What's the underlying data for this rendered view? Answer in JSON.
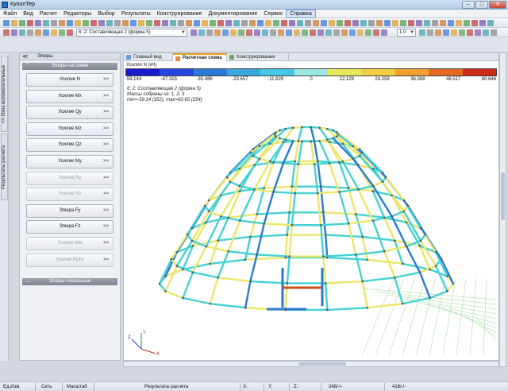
{
  "window": {
    "title": "КуполТер",
    "min": "–",
    "max": "□",
    "close": "✕"
  },
  "menu": [
    "Файл",
    "Вид",
    "Расчет",
    "Редакторы",
    "Выбор",
    "Результаты",
    "Конструирование",
    "Документирование",
    "Сервис",
    "Справка"
  ],
  "toolbar": {
    "combo_label": "6: 2: Составляющая 2 (форма 5)",
    "combo_small": "1.0"
  },
  "left_strip": {
    "tab1": "<< Окна вспомогательные",
    "tab2": "Результаты расчета"
  },
  "panel": {
    "header": "Эпюры",
    "section_scheme": "Эпюры на схеме",
    "buttons": [
      {
        "label": "Усилие N",
        "enabled": true
      },
      {
        "label": "Усилие Mx",
        "enabled": true
      },
      {
        "label": "Усилие Qy",
        "enabled": true
      },
      {
        "label": "Усилие Mz",
        "enabled": true
      },
      {
        "label": "Усилие Qz",
        "enabled": true
      },
      {
        "label": "Усилие My",
        "enabled": true
      },
      {
        "label": "Усилие Ry",
        "enabled": false
      },
      {
        "label": "Усилие Rz",
        "enabled": false
      },
      {
        "label": "Эпюра Fy",
        "enabled": true
      },
      {
        "label": "Эпюра Fz",
        "enabled": true
      },
      {
        "label": "Усилие Mw",
        "enabled": false
      },
      {
        "label": "Усилие Rphx",
        "enabled": false
      }
    ],
    "arrow": ">>",
    "section_local": "Эпюры локальные"
  },
  "tabs": [
    "Главный вид",
    "Расчетная схема",
    "Конструирование"
  ],
  "legend": {
    "title": "Усилия N (кН)",
    "colors": [
      "#1a1acc",
      "#2a44e0",
      "#2a7ad8",
      "#38a8e0",
      "#44c8e4",
      "#9ce8e0",
      "#e8e85a",
      "#f0d040",
      "#f0a030",
      "#e46a22",
      "#cc2a18"
    ],
    "ticks": [
      "-59.144",
      "-47.315",
      "-35.486",
      "-23.657",
      "-11.829",
      "0",
      "12.129",
      "24.259",
      "36.388",
      "48.517",
      "60.646"
    ]
  },
  "info": {
    "line1": "6: 2: Составляющая 2 (форма 5)",
    "line2": "Массы собраны из: 1, 2, 3",
    "line3": "min=-59.14 (352); max=60.65 (254)"
  },
  "axes": {
    "x": "X",
    "y": "Y",
    "z": "Z"
  },
  "status": {
    "units": "Ед.Изм.",
    "grid": "Сеть",
    "scale": "Масштаб",
    "mode": "Результаты расчета",
    "x": "X:",
    "y": "Y:",
    "z": "Z:",
    "count1": "248/-/-",
    "count2": "418/-/-"
  }
}
